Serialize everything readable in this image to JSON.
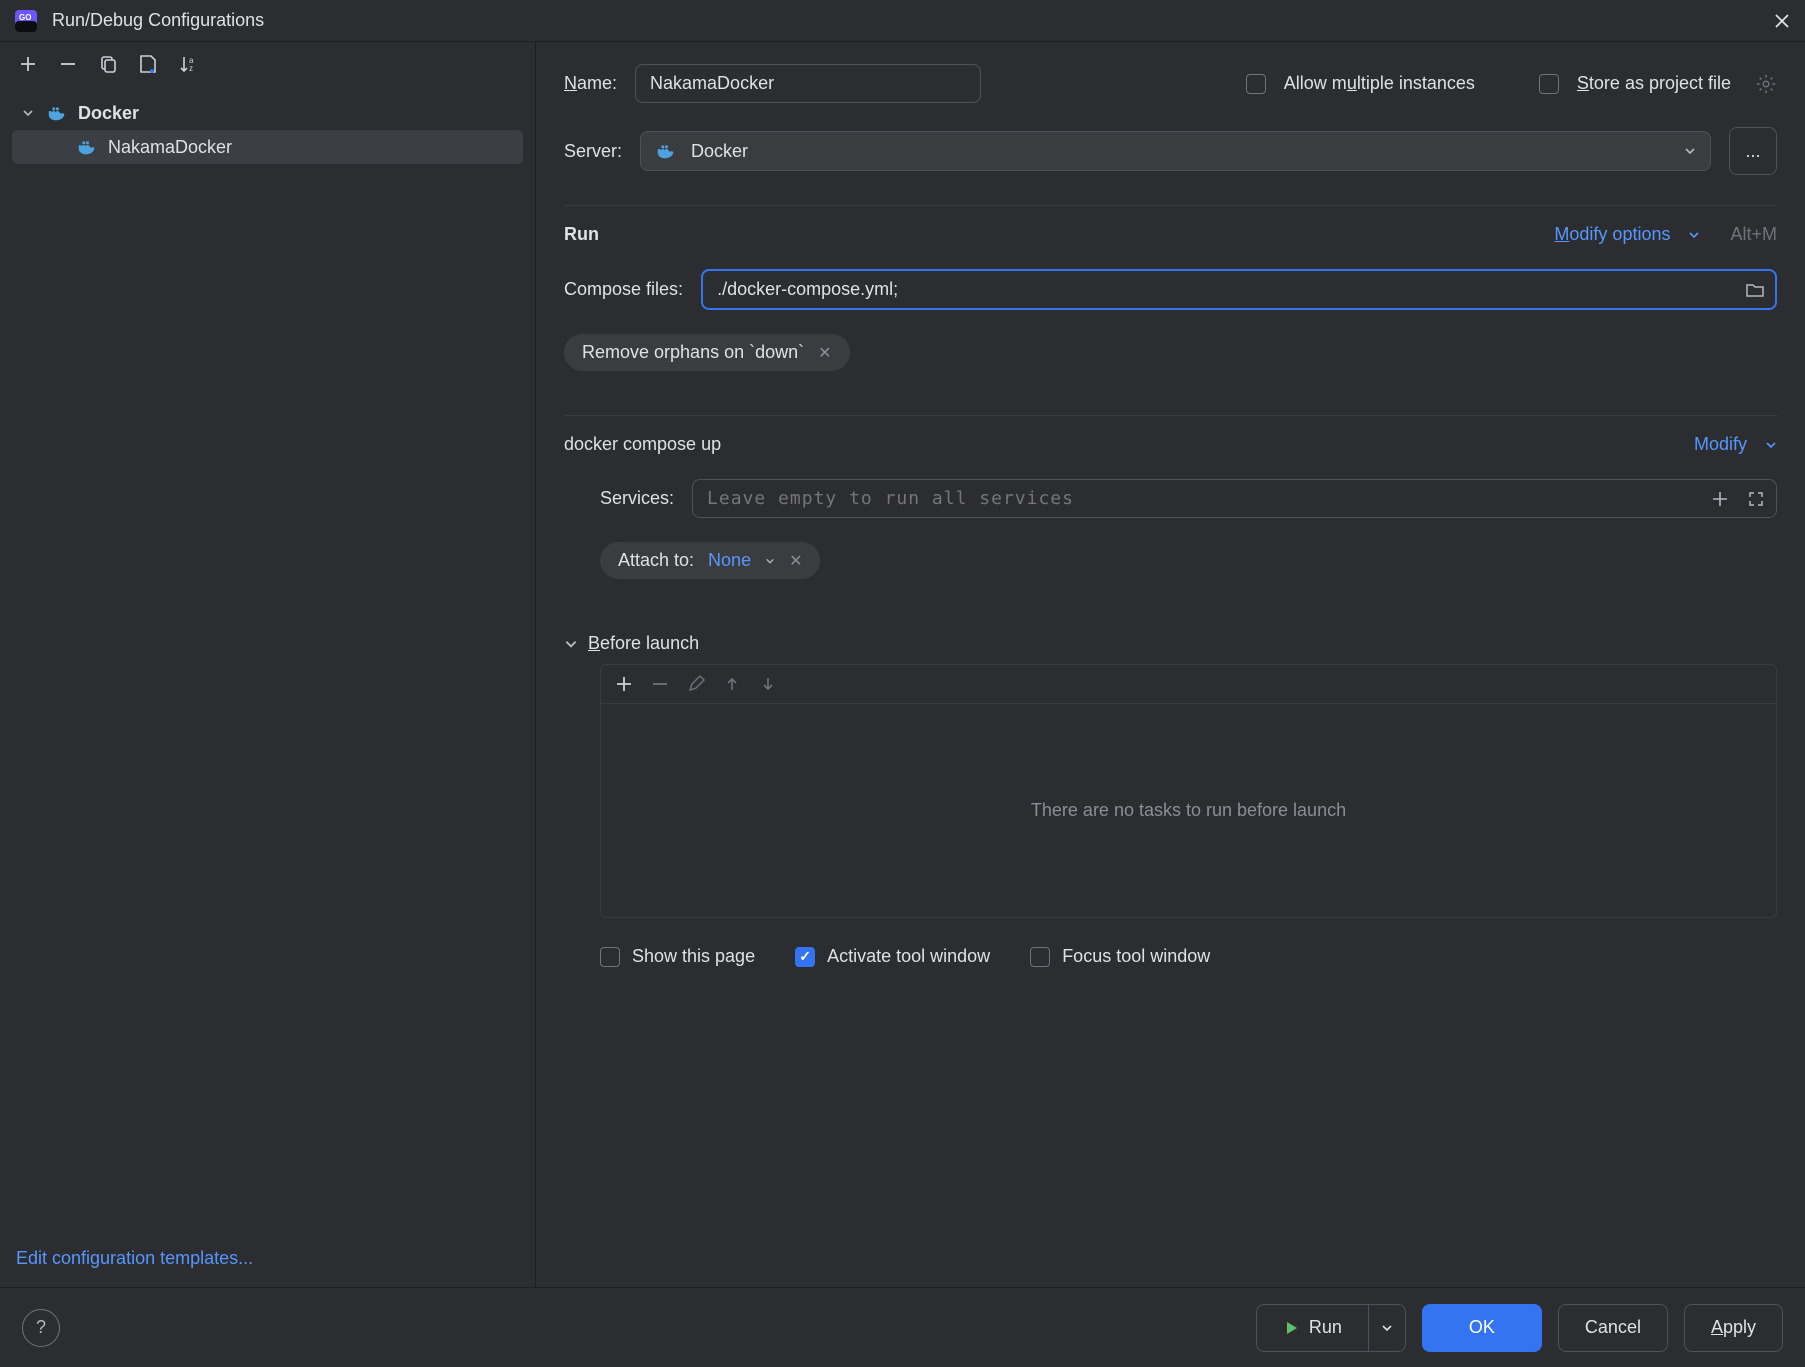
{
  "title": "Run/Debug Configurations",
  "tree": {
    "parent_label": "Docker",
    "child_label": "NakamaDocker"
  },
  "form": {
    "name_label": "Name:",
    "name_value": "NakamaDocker",
    "allow_multiple_label": "Allow multiple instances",
    "store_project_label": "Store as project file",
    "server_label": "Server:",
    "server_value": "Docker",
    "server_more": "...",
    "run_section": "Run",
    "modify_options": "Modify options",
    "modify_options_shortcut": "Alt+M",
    "compose_label": "Compose files:",
    "compose_value": "./docker-compose.yml;",
    "remove_orphans": "Remove orphans on `down`",
    "compose_up": "docker compose up",
    "modify": "Modify",
    "services_label": "Services:",
    "services_placeholder": "Leave empty to run all services",
    "attach_label": "Attach to:",
    "attach_value": "None",
    "before_launch": "Before launch",
    "before_empty": "There are no tasks to run before launch",
    "show_page": "Show this page",
    "activate_tool": "Activate tool window",
    "focus_tool": "Focus tool window",
    "edit_templates": "Edit configuration templates..."
  },
  "buttons": {
    "run": "Run",
    "ok": "OK",
    "cancel": "Cancel",
    "apply": "Apply"
  }
}
